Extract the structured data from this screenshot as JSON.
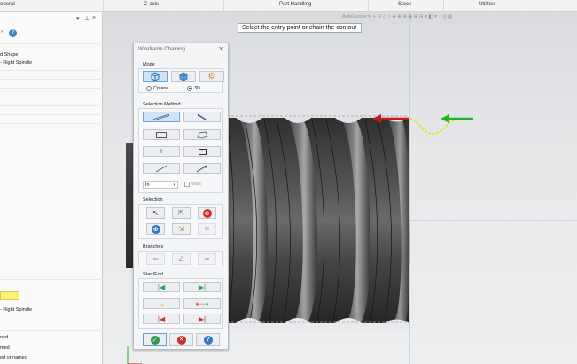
{
  "ribbon": {
    "tabs": [
      "eneral",
      "C-axis",
      "Part Handling",
      "Stock",
      "Utilities"
    ]
  },
  "left_panel": {
    "header_icons": [
      "chevron-down-icon",
      "pin-icon",
      "close-icon"
    ],
    "help_icon_text": "?",
    "items": [
      {
        "label": "d Shape"
      },
      {
        "label": "- Right Spindle"
      },
      {
        "label": "- Right Spindle"
      },
      {
        "label": "ned"
      },
      {
        "label": "med"
      },
      {
        "label": "ed or named"
      }
    ]
  },
  "viewport": {
    "toolbar_text": "AutoCursor ▾  ⊹ ⊡ ◇ ○ ◈ ⊕ ⊗ ◉ ⊞ ⊟ ▾ ◧ ▾ ◌ ◎ ◍",
    "prompt": "Select the entry point or chain the contour"
  },
  "dialog": {
    "title": "Wireframe Chaining",
    "close": "✕",
    "mode": {
      "label": "Mode",
      "radios": [
        {
          "label": "Cplane",
          "selected": false
        },
        {
          "label": "3D",
          "selected": true
        }
      ]
    },
    "selection_method": {
      "label": "Selection Method",
      "combo_value": "In",
      "wait_label": "Wait"
    },
    "selection": {
      "label": "Selection"
    },
    "branches": {
      "label": "Branches"
    },
    "start_end": {
      "label": "Start/End"
    }
  },
  "colors": {
    "accent_blue": "#3f86c8",
    "arrow_red": "#c71b1b",
    "arrow_green": "#24b324",
    "chain_yellow": "#e7e23a"
  }
}
